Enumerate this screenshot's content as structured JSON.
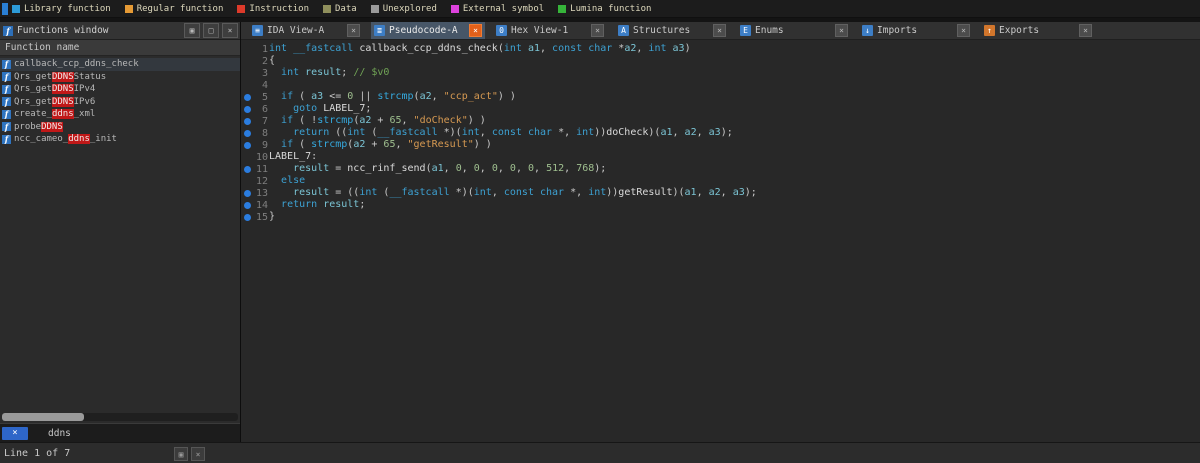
{
  "legend": {
    "items": [
      {
        "label": "Library function",
        "color": "#2d9bd8"
      },
      {
        "label": "Regular function",
        "color": "#e59a35"
      },
      {
        "label": "Instruction",
        "color": "#dd3a2a"
      },
      {
        "label": "Data",
        "color": "#8f8f5c"
      },
      {
        "label": "Unexplored",
        "color": "#9a9a9a"
      },
      {
        "label": "External symbol",
        "color": "#dd42dd"
      },
      {
        "label": "Lumina function",
        "color": "#36b43a"
      }
    ]
  },
  "functions_panel": {
    "title": "Functions window",
    "icon_glyph": "f",
    "window_buttons": [
      {
        "name": "restore-button",
        "glyph": "▣"
      },
      {
        "name": "float-button",
        "glyph": "□"
      },
      {
        "name": "close-button",
        "glyph": "×"
      }
    ],
    "header": "Function name",
    "rows": [
      {
        "selected": true,
        "parts": [
          [
            "t",
            "callback_ccp_ddns_check"
          ]
        ]
      },
      {
        "selected": false,
        "parts": [
          [
            "t",
            "Qrs_get"
          ],
          [
            "hl",
            "DDNS"
          ],
          [
            "t",
            "Status"
          ]
        ]
      },
      {
        "selected": false,
        "parts": [
          [
            "t",
            "Qrs_get"
          ],
          [
            "hl",
            "DDNS"
          ],
          [
            "t",
            "IPv4"
          ]
        ]
      },
      {
        "selected": false,
        "parts": [
          [
            "t",
            "Qrs_get"
          ],
          [
            "hl",
            "DDNS"
          ],
          [
            "t",
            "IPv6"
          ]
        ]
      },
      {
        "selected": false,
        "parts": [
          [
            "t",
            "create_"
          ],
          [
            "hl",
            "ddns"
          ],
          [
            "t",
            "_xml"
          ]
        ]
      },
      {
        "selected": false,
        "parts": [
          [
            "t",
            "probe"
          ],
          [
            "hl",
            "DDNS"
          ]
        ]
      },
      {
        "selected": false,
        "parts": [
          [
            "t",
            "ncc_cameo_"
          ],
          [
            "hl",
            "ddns"
          ],
          [
            "t",
            "_init"
          ]
        ]
      }
    ],
    "filter": {
      "clear_glyph": "×",
      "text": "ddns"
    }
  },
  "tab_close_glyph": "×",
  "tabs": [
    {
      "label": "IDA View-A",
      "icon": "ida-view-icon",
      "glyph": "≡",
      "icon_color": "#3d7ec6",
      "active": false
    },
    {
      "label": "Pseudocode-A",
      "icon": "pseudocode-icon",
      "glyph": "≣",
      "icon_color": "#3d7ec6",
      "active": true
    },
    {
      "label": "Hex View-1",
      "icon": "hex-view-icon",
      "glyph": "0",
      "icon_color": "#3d7ec6",
      "active": false
    },
    {
      "label": "Structures",
      "icon": "structures-icon",
      "glyph": "A",
      "icon_color": "#3d7ec6",
      "active": false
    },
    {
      "label": "Enums",
      "icon": "enums-icon",
      "glyph": "E",
      "icon_color": "#3d7ec6",
      "active": false
    },
    {
      "label": "Imports",
      "icon": "imports-icon",
      "glyph": "↓",
      "icon_color": "#3d7ec6",
      "active": false
    },
    {
      "label": "Exports",
      "icon": "exports-icon",
      "glyph": "↑",
      "icon_color": "#d2762c",
      "active": false
    }
  ],
  "code": {
    "lines": [
      {
        "n": 1,
        "dot": false,
        "segs": [
          [
            "kw",
            "int"
          ],
          [
            "d",
            " "
          ],
          [
            "kw",
            "__fastcall"
          ],
          [
            "d",
            " "
          ],
          [
            "fn",
            "callback_ccp_ddns_check"
          ],
          [
            "d",
            "("
          ],
          [
            "kw",
            "int"
          ],
          [
            "d",
            " "
          ],
          [
            "var",
            "a1"
          ],
          [
            "d",
            ", "
          ],
          [
            "kw",
            "const"
          ],
          [
            "d",
            " "
          ],
          [
            "kw",
            "char"
          ],
          [
            "d",
            " *"
          ],
          [
            "var",
            "a2"
          ],
          [
            "d",
            ", "
          ],
          [
            "kw",
            "int"
          ],
          [
            "d",
            " "
          ],
          [
            "var",
            "a3"
          ],
          [
            "d",
            ")"
          ]
        ]
      },
      {
        "n": 2,
        "dot": false,
        "segs": [
          [
            "d",
            "{"
          ]
        ]
      },
      {
        "n": 3,
        "dot": false,
        "segs": [
          [
            "d",
            "  "
          ],
          [
            "kw",
            "int"
          ],
          [
            "d",
            " "
          ],
          [
            "var",
            "result"
          ],
          [
            "d",
            "; "
          ],
          [
            "cm",
            "// $v0"
          ]
        ]
      },
      {
        "n": 4,
        "dot": false,
        "segs": []
      },
      {
        "n": 5,
        "dot": true,
        "segs": [
          [
            "d",
            "  "
          ],
          [
            "kw",
            "if"
          ],
          [
            "d",
            " ( "
          ],
          [
            "var",
            "a3"
          ],
          [
            "d",
            " <= "
          ],
          [
            "num",
            "0"
          ],
          [
            "d",
            " || "
          ],
          [
            "lib",
            "strcmp"
          ],
          [
            "d",
            "("
          ],
          [
            "var",
            "a2"
          ],
          [
            "d",
            ", "
          ],
          [
            "str",
            "\"ccp_act\""
          ],
          [
            "d",
            ") )"
          ]
        ]
      },
      {
        "n": 6,
        "dot": true,
        "segs": [
          [
            "d",
            "    "
          ],
          [
            "kw",
            "goto"
          ],
          [
            "d",
            " "
          ],
          [
            "lbl",
            "LABEL_7"
          ],
          [
            "d",
            ";"
          ]
        ]
      },
      {
        "n": 7,
        "dot": true,
        "segs": [
          [
            "d",
            "  "
          ],
          [
            "kw",
            "if"
          ],
          [
            "d",
            " ( !"
          ],
          [
            "lib",
            "strcmp"
          ],
          [
            "d",
            "("
          ],
          [
            "var",
            "a2"
          ],
          [
            "d",
            " + "
          ],
          [
            "num",
            "65"
          ],
          [
            "d",
            ", "
          ],
          [
            "str",
            "\"doCheck\""
          ],
          [
            "d",
            ") )"
          ]
        ]
      },
      {
        "n": 8,
        "dot": true,
        "segs": [
          [
            "d",
            "    "
          ],
          [
            "kw",
            "return"
          ],
          [
            "d",
            " (("
          ],
          [
            "kw",
            "int"
          ],
          [
            "d",
            " ("
          ],
          [
            "kw",
            "__fastcall"
          ],
          [
            "d",
            " *)("
          ],
          [
            "kw",
            "int"
          ],
          [
            "d",
            ", "
          ],
          [
            "kw",
            "const"
          ],
          [
            "d",
            " "
          ],
          [
            "kw",
            "char"
          ],
          [
            "d",
            " *, "
          ],
          [
            "kw",
            "int"
          ],
          [
            "d",
            "))"
          ],
          [
            "fn",
            "doCheck"
          ],
          [
            "d",
            ")("
          ],
          [
            "var",
            "a1"
          ],
          [
            "d",
            ", "
          ],
          [
            "var",
            "a2"
          ],
          [
            "d",
            ", "
          ],
          [
            "var",
            "a3"
          ],
          [
            "d",
            ");"
          ]
        ]
      },
      {
        "n": 9,
        "dot": true,
        "segs": [
          [
            "d",
            "  "
          ],
          [
            "kw",
            "if"
          ],
          [
            "d",
            " ( "
          ],
          [
            "lib",
            "strcmp"
          ],
          [
            "d",
            "("
          ],
          [
            "var",
            "a2"
          ],
          [
            "d",
            " + "
          ],
          [
            "num",
            "65"
          ],
          [
            "d",
            ", "
          ],
          [
            "str",
            "\"getResult\""
          ],
          [
            "d",
            ") )"
          ]
        ]
      },
      {
        "n": 10,
        "dot": false,
        "segs": [
          [
            "lbl",
            "LABEL_7"
          ],
          [
            "d",
            ":"
          ]
        ]
      },
      {
        "n": 11,
        "dot": true,
        "segs": [
          [
            "d",
            "    "
          ],
          [
            "var",
            "result"
          ],
          [
            "d",
            " = "
          ],
          [
            "fn",
            "ncc_rinf_send"
          ],
          [
            "d",
            "("
          ],
          [
            "var",
            "a1"
          ],
          [
            "d",
            ", "
          ],
          [
            "num",
            "0"
          ],
          [
            "d",
            ", "
          ],
          [
            "num",
            "0"
          ],
          [
            "d",
            ", "
          ],
          [
            "num",
            "0"
          ],
          [
            "d",
            ", "
          ],
          [
            "num",
            "0"
          ],
          [
            "d",
            ", "
          ],
          [
            "num",
            "0"
          ],
          [
            "d",
            ", "
          ],
          [
            "num",
            "512"
          ],
          [
            "d",
            ", "
          ],
          [
            "num",
            "768"
          ],
          [
            "d",
            ");"
          ]
        ]
      },
      {
        "n": 12,
        "dot": false,
        "segs": [
          [
            "d",
            "  "
          ],
          [
            "kw",
            "else"
          ]
        ]
      },
      {
        "n": 13,
        "dot": true,
        "segs": [
          [
            "d",
            "    "
          ],
          [
            "var",
            "result"
          ],
          [
            "d",
            " = (("
          ],
          [
            "kw",
            "int"
          ],
          [
            "d",
            " ("
          ],
          [
            "kw",
            "__fastcall"
          ],
          [
            "d",
            " *)("
          ],
          [
            "kw",
            "int"
          ],
          [
            "d",
            ", "
          ],
          [
            "kw",
            "const"
          ],
          [
            "d",
            " "
          ],
          [
            "kw",
            "char"
          ],
          [
            "d",
            " *, "
          ],
          [
            "kw",
            "int"
          ],
          [
            "d",
            "))"
          ],
          [
            "fn",
            "getResult"
          ],
          [
            "d",
            ")("
          ],
          [
            "var",
            "a1"
          ],
          [
            "d",
            ", "
          ],
          [
            "var",
            "a2"
          ],
          [
            "d",
            ", "
          ],
          [
            "var",
            "a3"
          ],
          [
            "d",
            ");"
          ]
        ]
      },
      {
        "n": 14,
        "dot": true,
        "segs": [
          [
            "d",
            "  "
          ],
          [
            "kw",
            "return"
          ],
          [
            "d",
            " "
          ],
          [
            "var",
            "result"
          ],
          [
            "d",
            ";"
          ]
        ]
      },
      {
        "n": 15,
        "dot": true,
        "segs": [
          [
            "d",
            "}"
          ]
        ]
      }
    ]
  },
  "status": {
    "line_info": "Line 1 of 7",
    "mini_buttons": [
      {
        "name": "dock-restore-button",
        "glyph": "▣"
      },
      {
        "name": "dock-close-button",
        "glyph": "×"
      }
    ]
  }
}
